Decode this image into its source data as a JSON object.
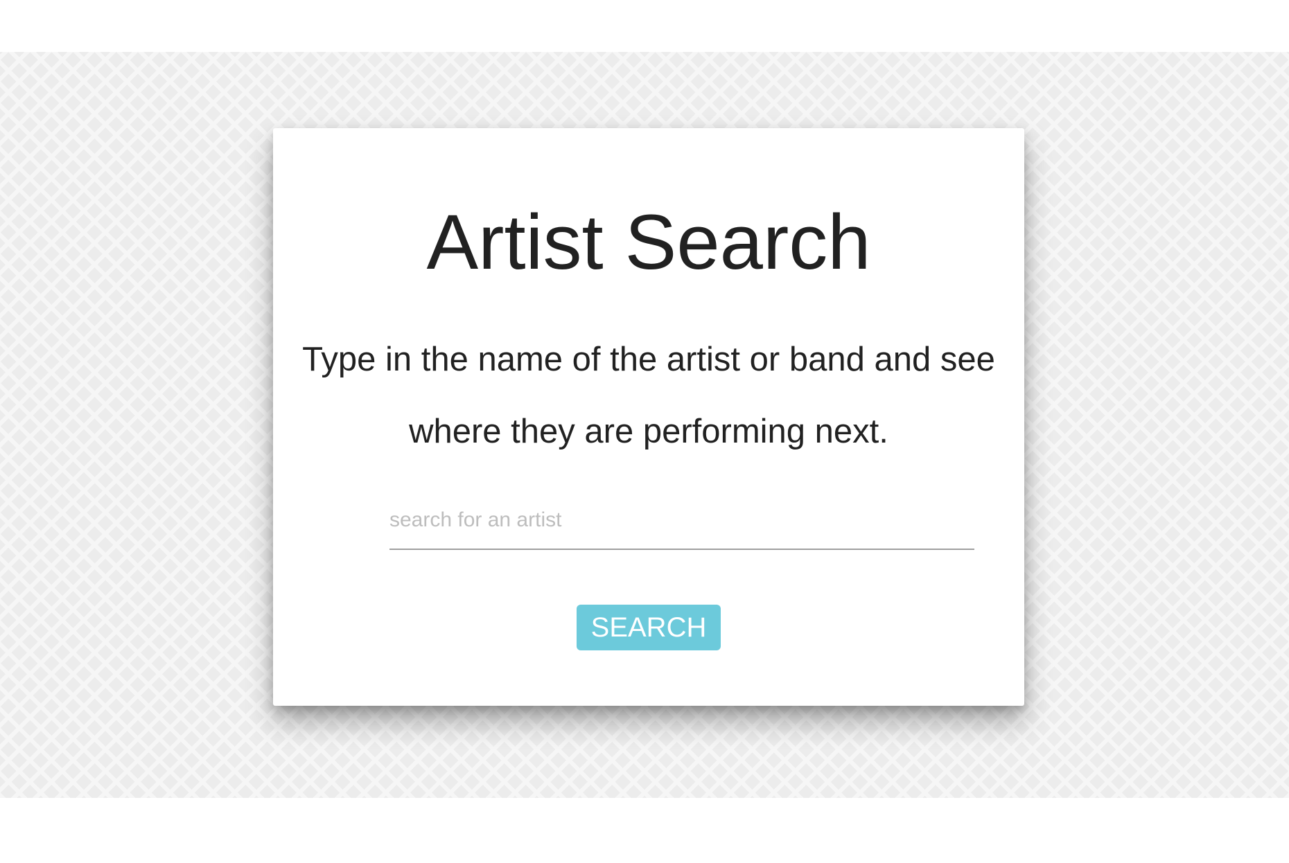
{
  "header": {
    "title": "Artist Search",
    "subtitle": "Type in the name of the artist or band and see where they are performing next."
  },
  "search": {
    "placeholder": "search for an artist",
    "value": "",
    "button_label": "SEARCH"
  },
  "colors": {
    "button": "#6ccadb",
    "text": "#212121",
    "placeholder": "#bdbdbd"
  }
}
